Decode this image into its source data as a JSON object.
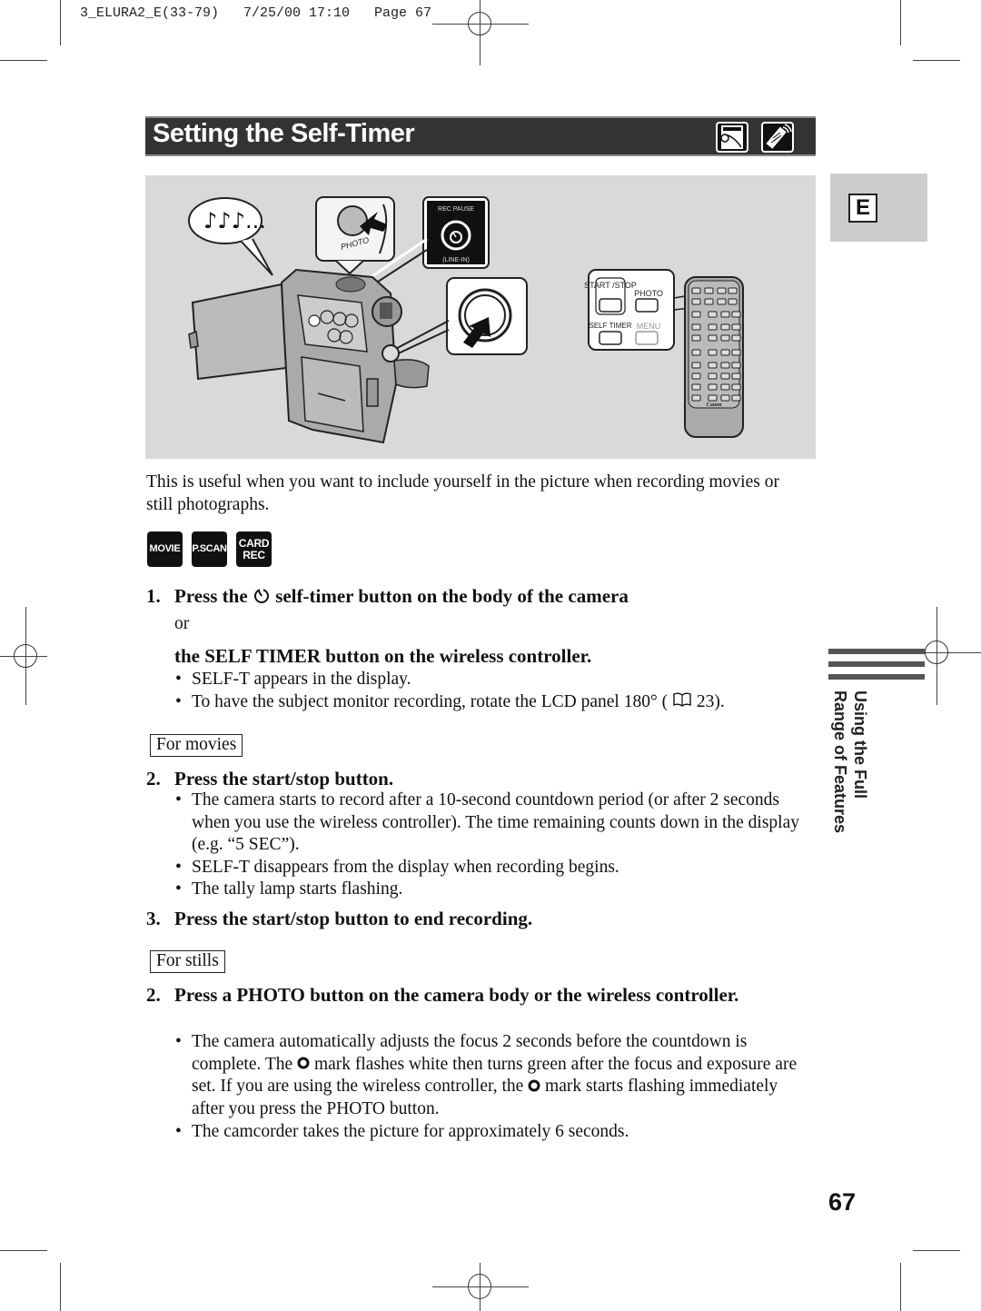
{
  "slug": "3_ELURA2_E(33-79)   7/25/00 17:10   Page 67",
  "title": "Setting the Self-Timer",
  "mode_icons": [
    "camera-body-icon",
    "wireless-controller-icon"
  ],
  "language_tab": "E",
  "illustration": {
    "sound_bubble": "♪♪♪...",
    "rec_pause_label": "REC PAUSE",
    "line_in_label": "(LINE-IN)",
    "photo_label": "PHOTO",
    "remote_buttons": {
      "start_stop": "START /STOP",
      "photo": "PHOTO",
      "self_timer": "SELF TIMER",
      "menu": "MENU"
    },
    "remote_brand": "Canon"
  },
  "intro": "This is useful when you want to include yourself in the picture when recording movies or still photographs.",
  "mode_badges": [
    "MOVIE",
    "P.SCAN",
    "CARD REC"
  ],
  "step1": {
    "number": "1.",
    "text_before": "Press the",
    "text_after": "self-timer button on the body of the camera",
    "or": "or",
    "alt": "the SELF TIMER button on the wireless controller.",
    "bullets": [
      "SELF-T appears in the display.",
      "To have the subject monitor recording, rotate the LCD panel 180° (",
      "23)."
    ]
  },
  "movies": {
    "label": "For movies",
    "step2": {
      "number": "2.",
      "text": "Press the start/stop button.",
      "bullets": [
        "The camera starts to record after a 10-second countdown period (or after 2 seconds when you use the wireless controller). The time remaining counts down in the display (e.g. “5 SEC”).",
        "SELF-T disappears from the display when recording begins.",
        "The tally lamp starts flashing."
      ]
    },
    "step3": {
      "number": "3.",
      "text": "Press the start/stop button to end recording."
    }
  },
  "stills": {
    "label": "For stills",
    "step2": {
      "number": "2.",
      "text": "Press a PHOTO button on the camera body or the wireless controller.",
      "bullet1_parts": [
        "The camera automatically adjusts the focus 2 seconds before the countdown is complete. The",
        "mark flashes white then turns green after the focus and exposure are set. If you are using the wireless controller, the",
        "mark starts flashing immediately after you press the PHOTO button."
      ],
      "bullet2": "The camcorder takes the picture for approximately 6 seconds."
    }
  },
  "side_section": [
    "Using the Full",
    "Range of Features"
  ],
  "page_number": "67"
}
